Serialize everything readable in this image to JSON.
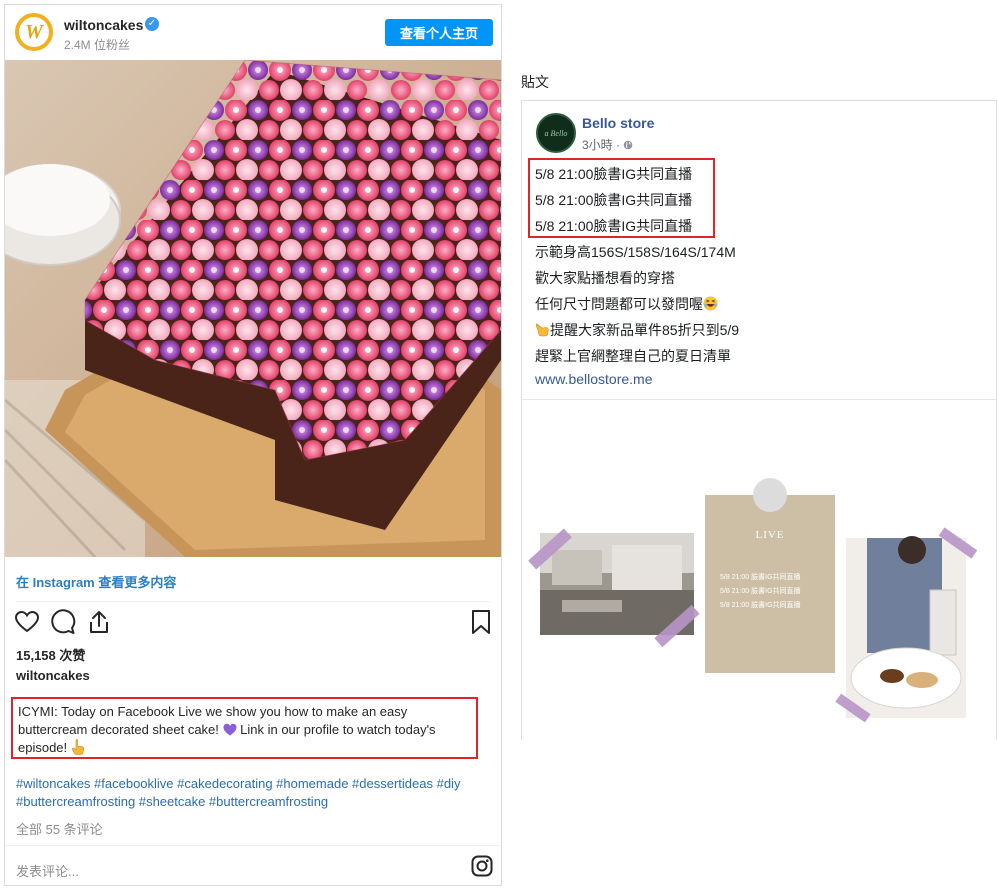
{
  "instagram": {
    "username": "wiltoncakes",
    "followers": "2.4M 位粉丝",
    "profile_button": "查看个人主页",
    "avatar_letter": "W",
    "more_link": "在 Instagram 查看更多内容",
    "likes": "15,158 次赞",
    "caption_user": "wiltoncakes",
    "caption_part1": "ICYMI: Today on Facebook Live we show you how to make an easy buttercream decorated sheet cake! ",
    "caption_part2": " Link in our profile to watch today's episode! ",
    "hashtags": "#wiltoncakes #facebooklive #cakedecorating #homemade #dessertideas #diy #buttercreamfrosting #sheetcake #buttercreamfrosting",
    "comments": "全部 55 条评论",
    "comment_placeholder": "发表评论...",
    "icons": [
      "heart-icon",
      "comment-icon",
      "share-icon",
      "bookmark-icon",
      "instagram-logo-icon",
      "verified-icon"
    ]
  },
  "facebook": {
    "section_label": "貼文",
    "page_name": "Bello store",
    "avatar_text": "a Bello",
    "time": "3小時 · ",
    "lines": [
      "5/8 21:00臉書IG共同直播",
      "5/8 21:00臉書IG共同直播",
      "5/8 21:00臉書IG共同直播",
      "示範身高156S/158S/164S/174M",
      "歡大家點播想看的穿搭",
      "任何尺寸問題都可以發問喔",
      "提醒大家新品單件85折只到5/9",
      "趕緊上官網整理自己的夏日清單"
    ],
    "link": "www.bellostore.me",
    "graphic": {
      "title": "LIVE",
      "schedule": [
        "5/8 21:00 臉書IG共同直播",
        "5/8 21:00 臉書IG共同直播",
        "5/8 21:00 臉書IG共同直播"
      ]
    }
  },
  "colors": {
    "ig_blue_button": "#0095f6",
    "ig_link": "#2a7fc4",
    "fb_link": "#385898",
    "highlight_red": "#e0252a"
  }
}
